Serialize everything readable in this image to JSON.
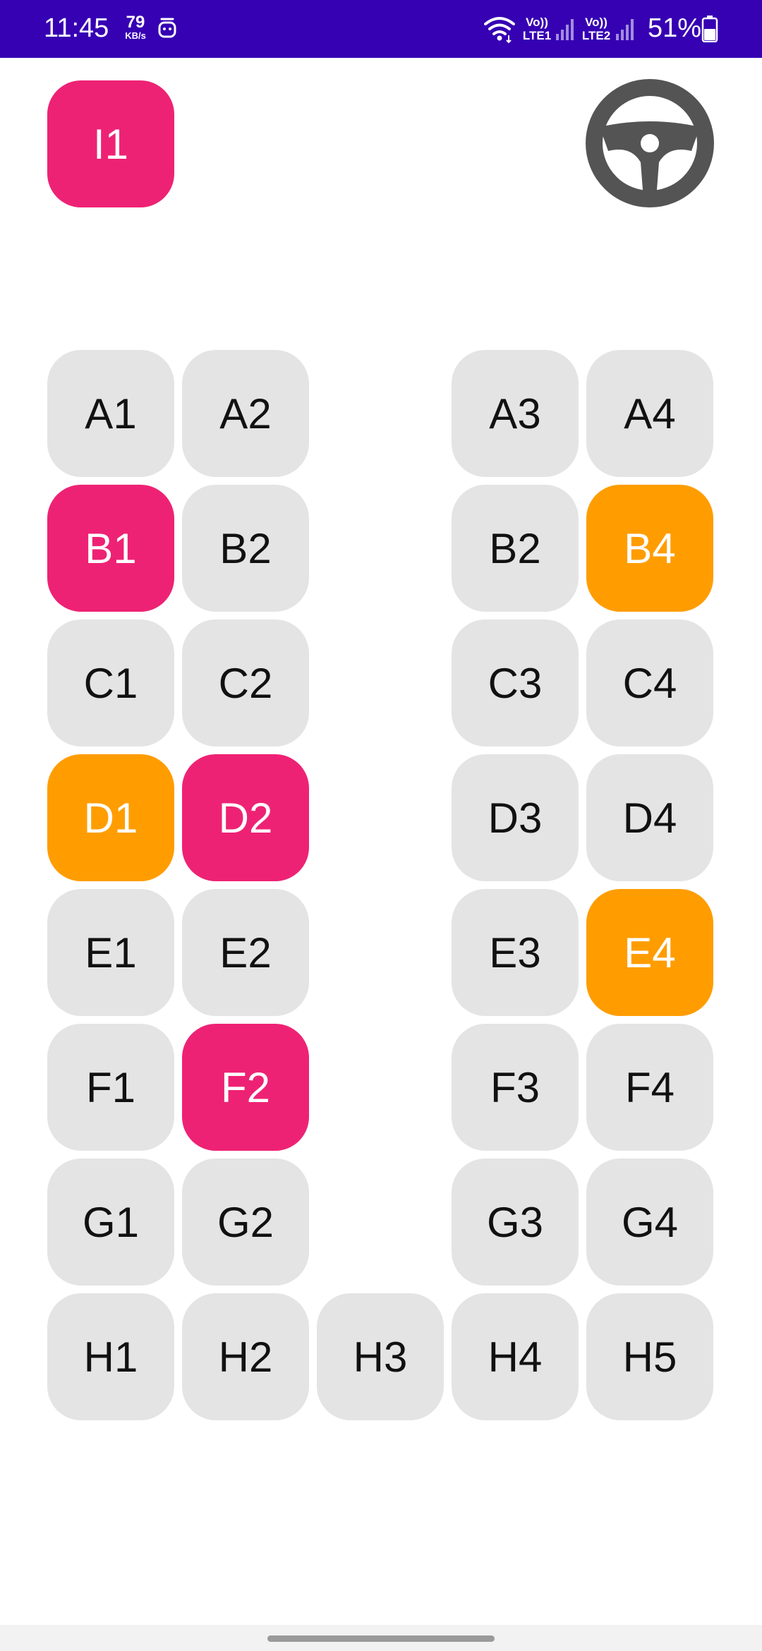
{
  "status_bar": {
    "time": "11:45",
    "net_speed_value": "79",
    "net_speed_unit": "KB/s",
    "sim1_line1": "Vo))",
    "sim1_line2": "LTE1",
    "sim2_line1": "Vo))",
    "sim2_line2": "LTE2",
    "battery_percent": "51%",
    "icons": [
      "notification-icon",
      "wifi-icon",
      "signal-icon",
      "battery-icon"
    ]
  },
  "colors": {
    "status_bar": "#3600b3",
    "seat_available": "#e4e4e4",
    "seat_selected": "#ee2274",
    "seat_booked": "#ff9d00",
    "steering_wheel": "#545454"
  },
  "driver_area": {
    "seat_label": "I1",
    "seat_state": "selected",
    "steering_icon": "steering-wheel-icon"
  },
  "seats": {
    "A1": "A1",
    "A2": "A2",
    "A3": "A3",
    "A4": "A4",
    "B1": "B1",
    "B2": "B2",
    "B3": "B2",
    "B4": "B4",
    "C1": "C1",
    "C2": "C2",
    "C3": "C3",
    "C4": "C4",
    "D1": "D1",
    "D2": "D2",
    "D3": "D3",
    "D4": "D4",
    "E1": "E1",
    "E2": "E2",
    "E3": "E3",
    "E4": "E4",
    "F1": "F1",
    "F2": "F2",
    "F3": "F3",
    "F4": "F4",
    "G1": "G1",
    "G2": "G2",
    "G3": "G3",
    "G4": "G4",
    "H1": "H1",
    "H2": "H2",
    "H3": "H3",
    "H4": "H4",
    "H5": "H5"
  }
}
